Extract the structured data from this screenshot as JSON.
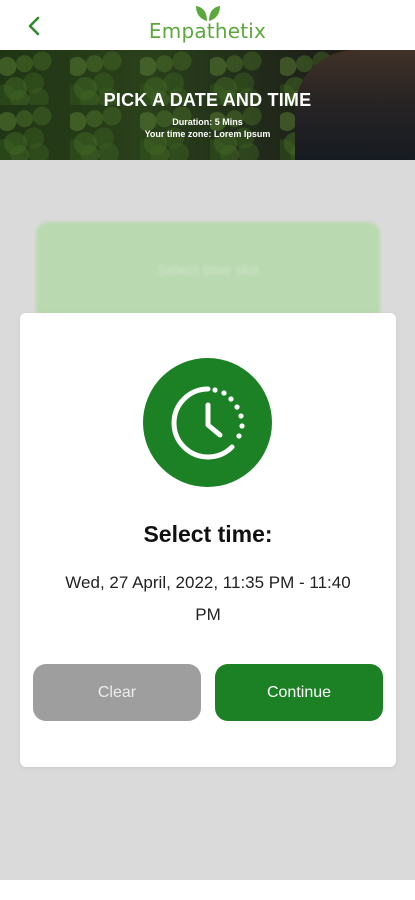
{
  "header": {
    "logo_text": "Empathetix",
    "back_icon": "chevron-left-icon",
    "accent_color": "#5da83d"
  },
  "hero": {
    "title": "PICK A DATE AND TIME",
    "duration": "Duration:  5 Mins",
    "timezone": "Your time zone: Lorem Ipsum"
  },
  "background_card": {
    "label": "Select time slot"
  },
  "modal": {
    "icon": "clock-icon",
    "title": "Select time:",
    "description": "Wed, 27 April, 2022, 11:35 PM - 11:40 PM",
    "clear_label": "Clear",
    "continue_label": "Continue",
    "primary_color": "#1b8124",
    "secondary_color": "#9e9e9e"
  }
}
